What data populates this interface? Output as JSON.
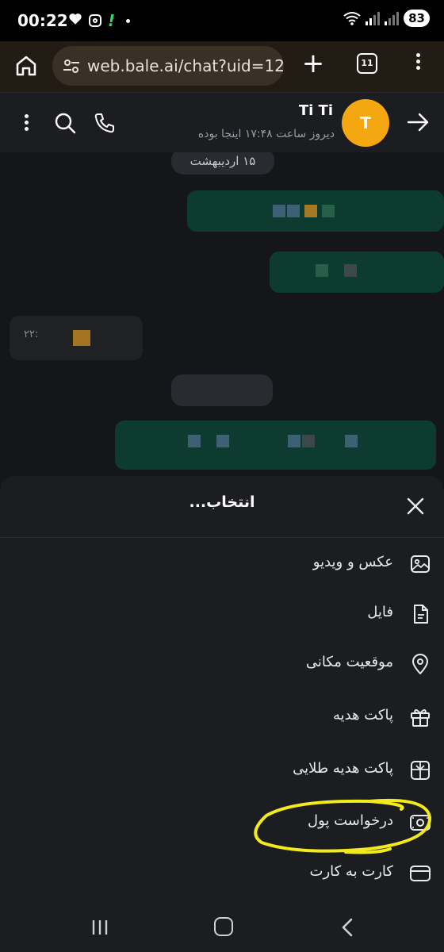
{
  "status_bar": {
    "time": "00:22",
    "battery": "83",
    "icons": [
      "heart-icon",
      "instagram-icon",
      "green-alert-icon",
      "dot-icon",
      "wifi-icon",
      "signal-icon",
      "signal-icon-2"
    ]
  },
  "browser": {
    "url": "web.bale.ai/chat?uid=12",
    "tab_count": "11"
  },
  "chat_header": {
    "name": "Ti Ti",
    "status": "دیروز ساعت ۱۷:۴۸ اینجا بوده",
    "avatar_letter": "T",
    "avatar_color": "#f5a712"
  },
  "chat": {
    "date_chip": "۱۵ اردیبهشت",
    "received_time": "۲۲:"
  },
  "sheet": {
    "title": "انتخاب...",
    "items": [
      {
        "label": "عکس و ویدیو",
        "icon": "image-icon"
      },
      {
        "label": "فایل",
        "icon": "file-icon"
      },
      {
        "label": "موقعیت مکانی",
        "icon": "location-pin-icon"
      },
      {
        "label": "پاکت هدیه",
        "icon": "gift-icon"
      },
      {
        "label": "پاکت هدیه طلایی",
        "icon": "golden-gift-icon"
      },
      {
        "label": "درخواست پول",
        "icon": "money-request-icon"
      },
      {
        "label": "کارت به کارت",
        "icon": "credit-card-icon"
      }
    ]
  },
  "colors": {
    "sheet_bg": "#1c1d21",
    "sent_bubble": "#0e3b2f",
    "highlight": "#f2ea1a"
  }
}
